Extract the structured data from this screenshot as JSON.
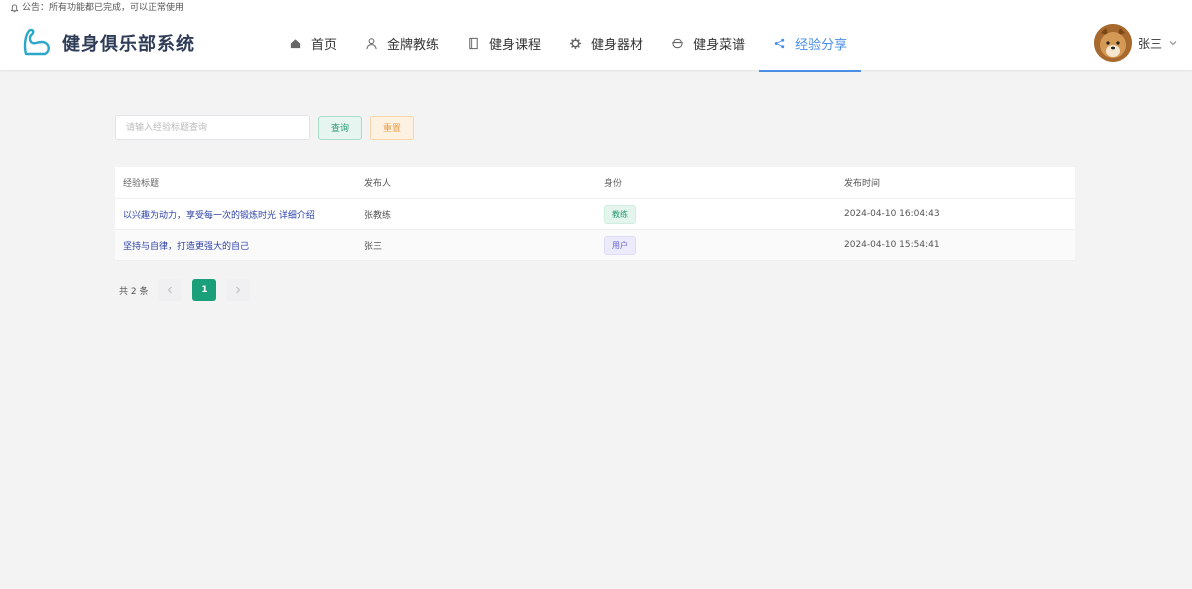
{
  "announcement": {
    "icon": "bell-icon",
    "text": "公告：所有功能都已完成，可以正常使用"
  },
  "header": {
    "logo_icon": "flexed-arm-icon",
    "app_title": "健身俱乐部系统",
    "nav": [
      {
        "label": "首页",
        "icon": "home-icon"
      },
      {
        "label": "金牌教练",
        "icon": "user-icon"
      },
      {
        "label": "健身课程",
        "icon": "book-icon"
      },
      {
        "label": "健身器材",
        "icon": "gear-icon"
      },
      {
        "label": "健身菜谱",
        "icon": "bowl-icon"
      },
      {
        "label": "经验分享",
        "icon": "share-icon",
        "active": true
      }
    ],
    "user": {
      "name": "张三"
    },
    "accent_color": "#4a8ee6"
  },
  "search": {
    "placeholder": "请输入经验标题查询",
    "value": "",
    "query_label": "查询",
    "reset_label": "重置"
  },
  "table": {
    "columns": [
      "经验标题",
      "发布人",
      "身份",
      "发布时间"
    ],
    "rows": [
      {
        "title": "以兴趣为动力，享受每一次的锻炼时光 详细介绍",
        "author": "张教练",
        "role": "教练",
        "time": "2024-04-10 16:04:43"
      },
      {
        "title": "坚持与自律，打造更强大的自己",
        "author": "张三",
        "role": "用户",
        "time": "2024-04-10 15:54:41"
      }
    ]
  },
  "pagination": {
    "total_text": "共 2 条",
    "current_page": "1"
  },
  "colors": {
    "primary_green": "#19a07a",
    "coach_tag": "#2a9d71",
    "user_tag": "#6b63d6",
    "reset": "#e3a04a"
  }
}
